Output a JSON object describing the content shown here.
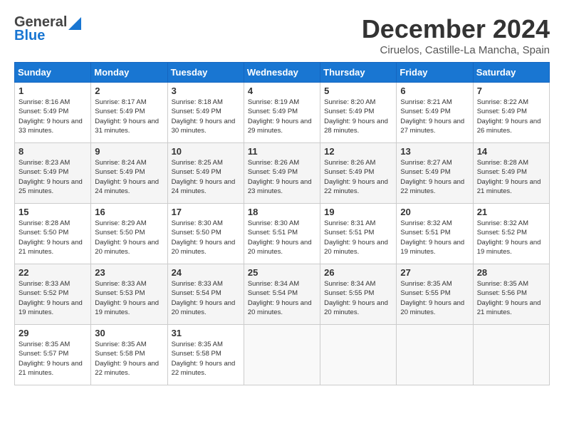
{
  "header": {
    "logo": {
      "general": "General",
      "blue": "Blue"
    },
    "title": "December 2024",
    "subtitle": "Ciruelos, Castille-La Mancha, Spain"
  },
  "weekdays": [
    "Sunday",
    "Monday",
    "Tuesday",
    "Wednesday",
    "Thursday",
    "Friday",
    "Saturday"
  ],
  "weeks": [
    [
      {
        "day": "1",
        "sunrise": "Sunrise: 8:16 AM",
        "sunset": "Sunset: 5:49 PM",
        "daylight": "Daylight: 9 hours and 33 minutes."
      },
      {
        "day": "2",
        "sunrise": "Sunrise: 8:17 AM",
        "sunset": "Sunset: 5:49 PM",
        "daylight": "Daylight: 9 hours and 31 minutes."
      },
      {
        "day": "3",
        "sunrise": "Sunrise: 8:18 AM",
        "sunset": "Sunset: 5:49 PM",
        "daylight": "Daylight: 9 hours and 30 minutes."
      },
      {
        "day": "4",
        "sunrise": "Sunrise: 8:19 AM",
        "sunset": "Sunset: 5:49 PM",
        "daylight": "Daylight: 9 hours and 29 minutes."
      },
      {
        "day": "5",
        "sunrise": "Sunrise: 8:20 AM",
        "sunset": "Sunset: 5:49 PM",
        "daylight": "Daylight: 9 hours and 28 minutes."
      },
      {
        "day": "6",
        "sunrise": "Sunrise: 8:21 AM",
        "sunset": "Sunset: 5:49 PM",
        "daylight": "Daylight: 9 hours and 27 minutes."
      },
      {
        "day": "7",
        "sunrise": "Sunrise: 8:22 AM",
        "sunset": "Sunset: 5:49 PM",
        "daylight": "Daylight: 9 hours and 26 minutes."
      }
    ],
    [
      {
        "day": "8",
        "sunrise": "Sunrise: 8:23 AM",
        "sunset": "Sunset: 5:49 PM",
        "daylight": "Daylight: 9 hours and 25 minutes."
      },
      {
        "day": "9",
        "sunrise": "Sunrise: 8:24 AM",
        "sunset": "Sunset: 5:49 PM",
        "daylight": "Daylight: 9 hours and 24 minutes."
      },
      {
        "day": "10",
        "sunrise": "Sunrise: 8:25 AM",
        "sunset": "Sunset: 5:49 PM",
        "daylight": "Daylight: 9 hours and 24 minutes."
      },
      {
        "day": "11",
        "sunrise": "Sunrise: 8:26 AM",
        "sunset": "Sunset: 5:49 PM",
        "daylight": "Daylight: 9 hours and 23 minutes."
      },
      {
        "day": "12",
        "sunrise": "Sunrise: 8:26 AM",
        "sunset": "Sunset: 5:49 PM",
        "daylight": "Daylight: 9 hours and 22 minutes."
      },
      {
        "day": "13",
        "sunrise": "Sunrise: 8:27 AM",
        "sunset": "Sunset: 5:49 PM",
        "daylight": "Daylight: 9 hours and 22 minutes."
      },
      {
        "day": "14",
        "sunrise": "Sunrise: 8:28 AM",
        "sunset": "Sunset: 5:49 PM",
        "daylight": "Daylight: 9 hours and 21 minutes."
      }
    ],
    [
      {
        "day": "15",
        "sunrise": "Sunrise: 8:28 AM",
        "sunset": "Sunset: 5:50 PM",
        "daylight": "Daylight: 9 hours and 21 minutes."
      },
      {
        "day": "16",
        "sunrise": "Sunrise: 8:29 AM",
        "sunset": "Sunset: 5:50 PM",
        "daylight": "Daylight: 9 hours and 20 minutes."
      },
      {
        "day": "17",
        "sunrise": "Sunrise: 8:30 AM",
        "sunset": "Sunset: 5:50 PM",
        "daylight": "Daylight: 9 hours and 20 minutes."
      },
      {
        "day": "18",
        "sunrise": "Sunrise: 8:30 AM",
        "sunset": "Sunset: 5:51 PM",
        "daylight": "Daylight: 9 hours and 20 minutes."
      },
      {
        "day": "19",
        "sunrise": "Sunrise: 8:31 AM",
        "sunset": "Sunset: 5:51 PM",
        "daylight": "Daylight: 9 hours and 20 minutes."
      },
      {
        "day": "20",
        "sunrise": "Sunrise: 8:32 AM",
        "sunset": "Sunset: 5:51 PM",
        "daylight": "Daylight: 9 hours and 19 minutes."
      },
      {
        "day": "21",
        "sunrise": "Sunrise: 8:32 AM",
        "sunset": "Sunset: 5:52 PM",
        "daylight": "Daylight: 9 hours and 19 minutes."
      }
    ],
    [
      {
        "day": "22",
        "sunrise": "Sunrise: 8:33 AM",
        "sunset": "Sunset: 5:52 PM",
        "daylight": "Daylight: 9 hours and 19 minutes."
      },
      {
        "day": "23",
        "sunrise": "Sunrise: 8:33 AM",
        "sunset": "Sunset: 5:53 PM",
        "daylight": "Daylight: 9 hours and 19 minutes."
      },
      {
        "day": "24",
        "sunrise": "Sunrise: 8:33 AM",
        "sunset": "Sunset: 5:54 PM",
        "daylight": "Daylight: 9 hours and 20 minutes."
      },
      {
        "day": "25",
        "sunrise": "Sunrise: 8:34 AM",
        "sunset": "Sunset: 5:54 PM",
        "daylight": "Daylight: 9 hours and 20 minutes."
      },
      {
        "day": "26",
        "sunrise": "Sunrise: 8:34 AM",
        "sunset": "Sunset: 5:55 PM",
        "daylight": "Daylight: 9 hours and 20 minutes."
      },
      {
        "day": "27",
        "sunrise": "Sunrise: 8:35 AM",
        "sunset": "Sunset: 5:55 PM",
        "daylight": "Daylight: 9 hours and 20 minutes."
      },
      {
        "day": "28",
        "sunrise": "Sunrise: 8:35 AM",
        "sunset": "Sunset: 5:56 PM",
        "daylight": "Daylight: 9 hours and 21 minutes."
      }
    ],
    [
      {
        "day": "29",
        "sunrise": "Sunrise: 8:35 AM",
        "sunset": "Sunset: 5:57 PM",
        "daylight": "Daylight: 9 hours and 21 minutes."
      },
      {
        "day": "30",
        "sunrise": "Sunrise: 8:35 AM",
        "sunset": "Sunset: 5:58 PM",
        "daylight": "Daylight: 9 hours and 22 minutes."
      },
      {
        "day": "31",
        "sunrise": "Sunrise: 8:35 AM",
        "sunset": "Sunset: 5:58 PM",
        "daylight": "Daylight: 9 hours and 22 minutes."
      },
      {
        "day": "",
        "sunrise": "",
        "sunset": "",
        "daylight": ""
      },
      {
        "day": "",
        "sunrise": "",
        "sunset": "",
        "daylight": ""
      },
      {
        "day": "",
        "sunrise": "",
        "sunset": "",
        "daylight": ""
      },
      {
        "day": "",
        "sunrise": "",
        "sunset": "",
        "daylight": ""
      }
    ]
  ]
}
